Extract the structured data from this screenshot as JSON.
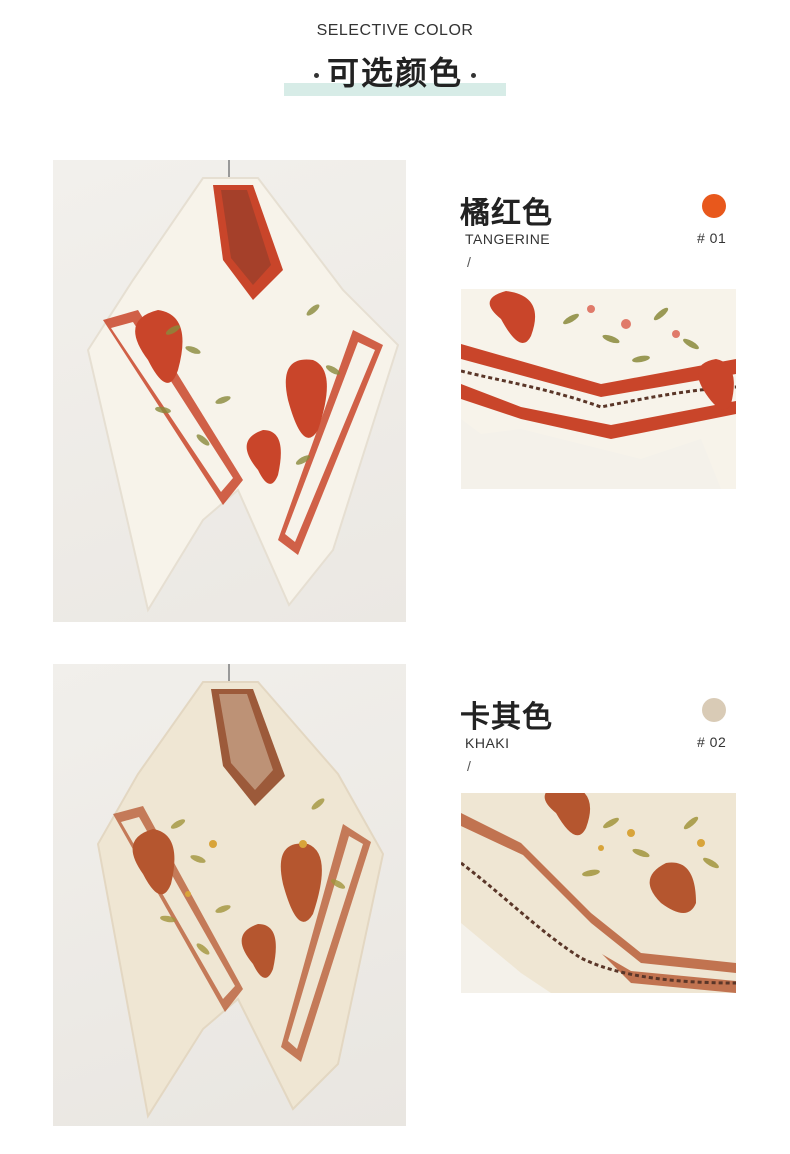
{
  "header": {
    "title_en": "SELECTIVE COLOR",
    "title_zh": "可选颜色"
  },
  "products": [
    {
      "name_zh": "橘红色",
      "name_en": "TANGERINE",
      "separator": "/",
      "code": "# 01",
      "swatch_color": "#e8581c",
      "accent": "#c9452a",
      "base": "#f6f3ec",
      "leaf": "#8a8a3c"
    },
    {
      "name_zh": "卡其色",
      "name_en": "KHAKI",
      "separator": "/",
      "code": "# 02",
      "swatch_color": "#d9cbb6",
      "accent": "#b5562f",
      "base": "#efe6d3",
      "leaf": "#a2953d"
    }
  ]
}
